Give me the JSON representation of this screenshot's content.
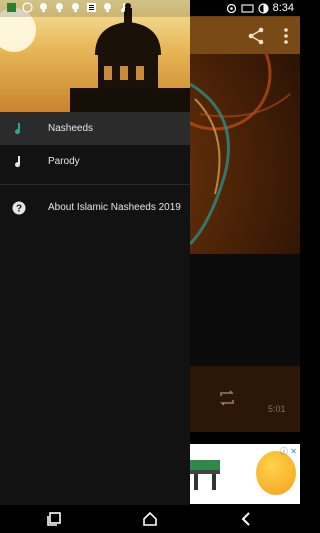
{
  "status_bar": {
    "time": "8:34",
    "left_icons": [
      "app-icon",
      "whatsapp-icon",
      "bulb-icon",
      "bulb-icon",
      "bulb-icon",
      "news-icon",
      "bulb-icon",
      "music-note-icon"
    ],
    "right_icons": [
      "hotspot-icon",
      "cast-icon",
      "data-saver-icon"
    ]
  },
  "drawer": {
    "items": [
      {
        "label": "Nasheeds",
        "icon": "music-note-icon",
        "active": true,
        "icon_color": "#2aa88e"
      },
      {
        "label": "Parody",
        "icon": "music-note-icon",
        "active": false,
        "icon_color": "#e6e6e6"
      },
      {
        "label": "About Islamic Nasheeds 2019",
        "icon": "help-icon",
        "active": false,
        "icon_color": "#e6e6e6"
      }
    ]
  },
  "player": {
    "duration": "5:01"
  },
  "ad": {
    "info_label": "ⓘ ✕"
  },
  "nav_bar": {
    "buttons": [
      "recents-button",
      "home-button",
      "back-button"
    ]
  }
}
